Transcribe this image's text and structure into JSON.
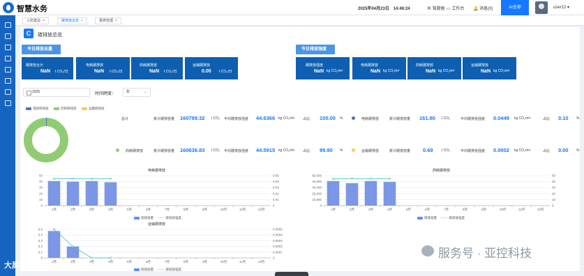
{
  "app": {
    "title": "智慧水务",
    "datetime": "2025年04月23日　14:46:24",
    "cockpit": "驾驶舱",
    "workbench": "工作台",
    "messages": "消息(0)",
    "ai_button": "AI全部",
    "user": "user12"
  },
  "sidebar": {
    "icons": [
      "monitor-icon",
      "device-icon",
      "chart-icon",
      "home-icon",
      "table-icon",
      "shield-icon",
      "settings-icon",
      "document-icon"
    ]
  },
  "tabs": [
    {
      "label": "三防建设"
    },
    {
      "label": "碳排放总览",
      "active": true
    },
    {
      "label": "报表管理"
    }
  ],
  "page": {
    "title": "碳排放总览"
  },
  "today": {
    "emission_label": "今日排放总量",
    "intensity_label": "今日排放强度",
    "emission_cards": [
      {
        "label": "碳排放合计",
        "value": "NaN",
        "unit": "t CO₂/日"
      },
      {
        "label": "电耗碳排放",
        "value": "NaN",
        "unit": "t CO₂/日"
      },
      {
        "label": "药耗碳排放",
        "value": "NaN",
        "unit": "t CO₂/日"
      },
      {
        "label": "运输碳排放",
        "value": "0.00",
        "unit": "t CO₂/日"
      }
    ],
    "intensity_cards": [
      {
        "label": "碳排放强度",
        "value": "NaN",
        "unit": "kg CO₂/m³"
      },
      {
        "label": "电耗碳排放",
        "value": "NaN",
        "unit": "kg CO₂/m³"
      },
      {
        "label": "药耗碳排放",
        "value": "NaN",
        "unit": "kg CO₂/m³"
      },
      {
        "label": "运输碳排放",
        "value": "NaN",
        "unit": "kg CO₂/m³"
      }
    ]
  },
  "filters": {
    "year": "2025",
    "span_label": "时间跨度：",
    "span_value": "年"
  },
  "donut": {
    "legend": [
      {
        "name": "电耗碳排放",
        "color": "#5470c6"
      },
      {
        "name": "药耗碳排放",
        "color": "#91cc75"
      },
      {
        "name": "运输碳排放",
        "color": "#fac858"
      }
    ],
    "segments": [
      {
        "name": "电耗碳排放",
        "value": 0.1,
        "color": "#5470c6"
      },
      {
        "name": "药耗碳排放",
        "value": 99.9,
        "color": "#91cc75"
      },
      {
        "name": "运输碳排放",
        "value": 0.0,
        "color": "#fac858"
      }
    ]
  },
  "summary": {
    "total": {
      "label": "总计",
      "emission_label": "累计碳排放量",
      "emission": "160799.32",
      "emission_unit": "t CO₂",
      "intensity_label": "平均碳排放强度",
      "intensity": "44.6366",
      "intensity_unit": "kg CO₂/m³",
      "share_label": "占比:",
      "share": "100.00",
      "share_unit": "%"
    },
    "electric": {
      "label": "电耗碳排放",
      "emission_label": "累计碳排放量",
      "emission": "161.80",
      "emission_unit": "t CO₂",
      "intensity_label": "平均碳排放强度",
      "intensity": "0.0449",
      "intensity_unit": "kg CO₂/m³",
      "share_label": "占比",
      "share": "0.10",
      "share_unit": "%",
      "color": "#5470c6"
    },
    "chemical": {
      "label": "药耗碳排放",
      "emission_label": "累计碳排放量",
      "emission": "160636.83",
      "emission_unit": "t CO₂",
      "intensity_label": "平均碳排放强度",
      "intensity": "44.5915",
      "intensity_unit": "kg CO₂/m³",
      "share_label": "占比:",
      "share": "99.90",
      "share_unit": "%",
      "color": "#91cc75"
    },
    "transport": {
      "label": "运输碳排放",
      "emission_label": "累计碳排放量",
      "emission": "0.69",
      "emission_unit": "t CO₂",
      "intensity_label": "平均碳排放强度",
      "intensity": "0.0002",
      "intensity_unit": "kg CO₂/m³",
      "share_label": "占比",
      "share": "0.00",
      "share_unit": "%",
      "color": "#fac858"
    }
  },
  "chart_data": [
    {
      "type": "bar",
      "title": "电耗碳排放",
      "categories": [
        "1月",
        "2月",
        "3月",
        "4月",
        "5月",
        "6月",
        "7月",
        "8月",
        "9月",
        "10月",
        "11月",
        "12月"
      ],
      "series": [
        {
          "name": "碳排放量",
          "values": [
            41,
            40,
            41,
            39,
            null,
            null,
            null,
            null,
            null,
            null,
            null,
            null
          ]
        },
        {
          "name": "碳排放强度",
          "type": "line",
          "axis": "right",
          "values": [
            0.045,
            0.045,
            0.045,
            0.045,
            null,
            null,
            null,
            null,
            null,
            null,
            null,
            null
          ]
        }
      ],
      "ylim": [
        0,
        50
      ],
      "y_ticks": [
        0,
        10,
        20,
        30,
        40,
        50
      ],
      "y2lim": [
        0,
        0.05
      ],
      "y2_ticks": [
        0,
        0.01,
        0.02,
        0.03,
        0.04,
        0.05
      ]
    },
    {
      "type": "bar",
      "title": "药耗碳排放",
      "categories": [
        "1月",
        "2月",
        "3月",
        "4月",
        "5月",
        "6月",
        "7月",
        "8月",
        "9月",
        "10月",
        "11月",
        "12月"
      ],
      "series": [
        {
          "name": "碳排放量",
          "values": [
            41000,
            37500,
            41000,
            39500,
            null,
            null,
            null,
            null,
            null,
            null,
            null,
            null
          ]
        },
        {
          "name": "碳排放强度",
          "type": "line",
          "axis": "right",
          "values": [
            45,
            45,
            45,
            45,
            null,
            null,
            null,
            null,
            null,
            null,
            null,
            null
          ]
        }
      ],
      "ylim": [
        0,
        50000
      ],
      "y_ticks": [
        0,
        10000,
        20000,
        30000,
        40000,
        50000
      ],
      "y_tick_labels": [
        "0",
        "10,000",
        "20,000",
        "30,000",
        "40,000",
        "50,000"
      ],
      "y2lim": [
        0,
        50
      ],
      "y2_ticks": [
        0,
        10,
        20,
        30,
        40,
        50
      ]
    },
    {
      "type": "bar",
      "title": "运输碳排放",
      "categories": [
        "1月",
        "2月",
        "3月",
        "4月",
        "5月",
        "6月",
        "7月",
        "8月",
        "9月",
        "10月",
        "11月",
        "12月"
      ],
      "series": [
        {
          "name": "碳排放量",
          "values": [
            0.47,
            0.2,
            0,
            0,
            null,
            null,
            null,
            null,
            null,
            null,
            null,
            null
          ]
        },
        {
          "name": "碳排放强度",
          "type": "line",
          "axis": "right",
          "values": [
            0.0005,
            0.0002,
            0,
            0,
            null,
            null,
            null,
            null,
            null,
            null,
            null,
            null
          ]
        }
      ],
      "ylim": [
        0,
        0.5
      ],
      "y_ticks": [
        0,
        0.1,
        0.2,
        0.3,
        0.4,
        0.5
      ],
      "y2lim": [
        0,
        0.0005
      ],
      "y2_ticks": [
        0,
        0.0001,
        0.0002,
        0.0003,
        0.0004,
        0.0005
      ]
    }
  ],
  "watermark": {
    "text": "服务号 · 亚控科技",
    "bottom_left": "大屏模板"
  }
}
